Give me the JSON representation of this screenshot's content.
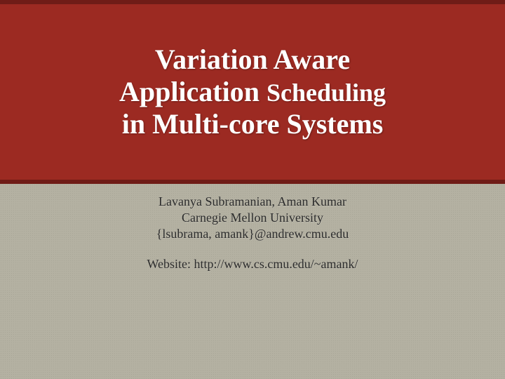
{
  "title": {
    "line1": "Variation Aware",
    "line2a": "Application ",
    "line2b": "Scheduling",
    "line3": "in Multi-core Systems"
  },
  "meta": {
    "authors": "Lavanya Subramanian, Aman Kumar",
    "affiliation": "Carnegie Mellon University",
    "emails": "{lsubrama, amank}@andrew.cmu.edu",
    "website": "Website: http://www.cs.cmu.edu/~amank/"
  }
}
